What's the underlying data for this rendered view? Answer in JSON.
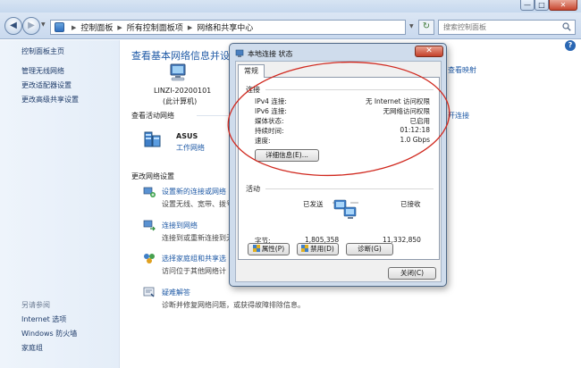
{
  "window": {
    "minimize_glyph": "—",
    "maximize_glyph": "□",
    "close_glyph": "✕"
  },
  "address": {
    "crumbs": [
      "控制面板",
      "所有控制面板项",
      "网络和共享中心"
    ],
    "search_placeholder": "搜索控制面板"
  },
  "sidebar": {
    "home": "控制面板主页",
    "links": [
      "管理无线网络",
      "更改适配器设置",
      "更改高级共享设置"
    ],
    "see_also_header": "另请参阅",
    "see_also": [
      "Internet 选项",
      "Windows 防火墙",
      "家庭组"
    ]
  },
  "main": {
    "title": "查看基本网络信息并设",
    "computer_name": "LINZI-20200101",
    "computer_sub": "(此计算机)",
    "active_header": "查看活动网络",
    "network_name": "ASUS",
    "network_type": "工作网络",
    "right_link_map": "查看映射",
    "right_link_disconnect": "开连接",
    "change_header": "更改网络设置",
    "tasks": [
      {
        "link": "设置新的连接或网络",
        "desc": "设置无线、宽带、拨号"
      },
      {
        "link": "连接到网络",
        "desc": "连接到或重新连接到无"
      },
      {
        "link": "选择家庭组和共享选",
        "desc": "访问位于其他网络计"
      },
      {
        "link": "疑难解答",
        "desc": "诊断并修复网络问题，或获得故障排除信息。"
      }
    ]
  },
  "dialog": {
    "title": "本地连接 状态",
    "close_glyph": "✕",
    "tab": "常规",
    "connection_header": "连接",
    "rows": [
      {
        "key": "IPv4 连接:",
        "value": "无 Internet 访问权限"
      },
      {
        "key": "IPv6 连接:",
        "value": "无网络访问权限"
      },
      {
        "key": "媒体状态:",
        "value": "已启用"
      },
      {
        "key": "持续时间:",
        "value": "01:12:18"
      },
      {
        "key": "速度:",
        "value": "1.0 Gbps"
      }
    ],
    "details_button": "详细信息(E)...",
    "activity_header": "活动",
    "sent_label": "已发送",
    "received_label": "已接收",
    "bytes_label": "字节:",
    "bytes_sent": "1,805,358",
    "bytes_received": "11,332,850",
    "properties_button": "属性(P)",
    "disable_button": "禁用(D)",
    "diagnose_button": "诊断(G)",
    "close_button": "关闭(C)"
  },
  "colors": {
    "link": "#1f5aa6",
    "annotation": "#d0281e"
  }
}
